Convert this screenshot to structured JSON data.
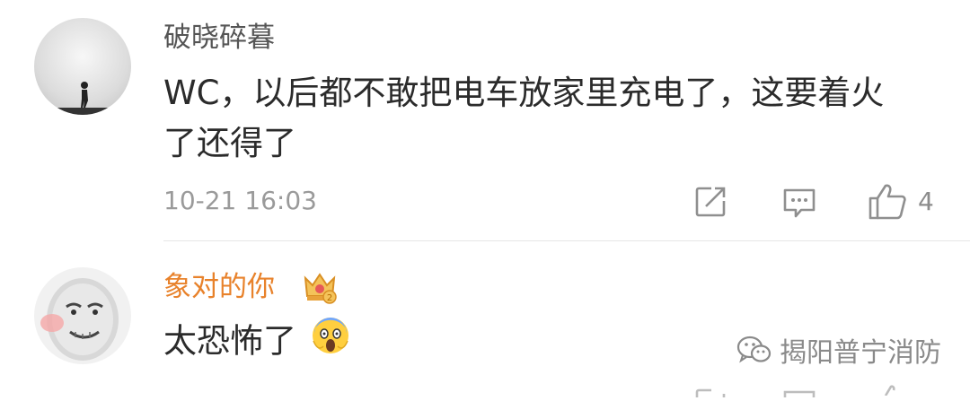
{
  "comments": [
    {
      "username": "破晓碎暮",
      "text_line1": "WC，以后都不敢把电车放家里充电了，这要着火",
      "text_line2": "了还得了",
      "time": "10-21 16:03",
      "likes": "4",
      "avatar_icon": "silhouette-figure-avatar",
      "username_color": "#555555"
    },
    {
      "username": "象对的你",
      "text": "太恐怖了",
      "emoji": "scream-emoji",
      "badge_icon": "crown-badge-icon",
      "avatar_icon": "meme-face-avatar",
      "username_color": "#e8822b"
    }
  ],
  "watermark": {
    "text": "揭阳普宁消防",
    "icon": "wechat-icon"
  },
  "icons": {
    "share": "share-icon",
    "reply": "reply-icon",
    "like": "thumbs-up-icon"
  }
}
